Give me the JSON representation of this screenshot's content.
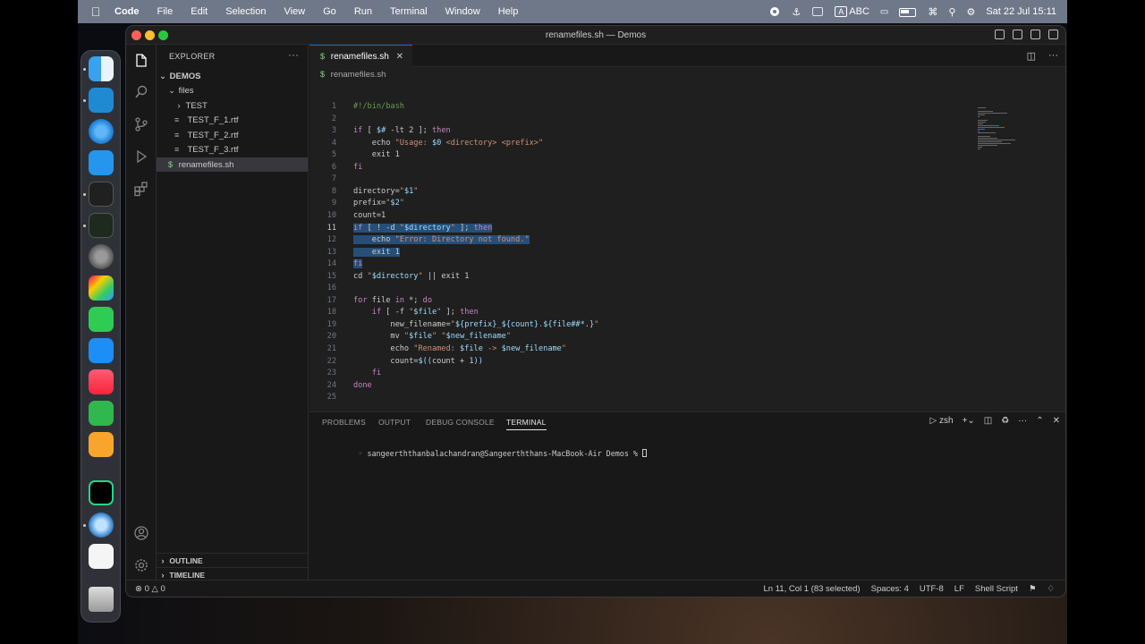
{
  "menubar": {
    "app": "Code",
    "items": [
      "File",
      "Edit",
      "Selection",
      "View",
      "Go",
      "Run",
      "Terminal",
      "Window",
      "Help"
    ],
    "input_source": "ABC",
    "datetime": "Sat 22 Jul  15:11"
  },
  "window": {
    "title": "renamefiles.sh — Demos"
  },
  "sidebar": {
    "header": "EXPLORER",
    "more": "···",
    "root": "DEMOS",
    "tree": [
      {
        "label": "files"
      },
      {
        "label": "TEST"
      },
      {
        "label": "TEST_F_1.rtf"
      },
      {
        "label": "TEST_F_2.rtf"
      },
      {
        "label": "TEST_F_3.rtf"
      },
      {
        "label": "renamefiles.sh"
      }
    ],
    "outline": "OUTLINE",
    "timeline": "TIMELINE"
  },
  "editor": {
    "tab": "renamefiles.sh",
    "breadcrumb": "renamefiles.sh",
    "current_line": 11
  },
  "panel": {
    "tabs": [
      "PROBLEMS",
      "OUTPUT",
      "DEBUG CONSOLE",
      "TERMINAL"
    ],
    "active_tab": "TERMINAL",
    "shell": "zsh",
    "prompt": "sangeerththanbalachandran@Sangeerththans-MacBook-Air Demos % "
  },
  "statusbar": {
    "errors": "0",
    "warnings": "0",
    "position": "Ln 11, Col 1 (83 selected)",
    "spaces": "Spaces: 4",
    "encoding": "UTF-8",
    "eol": "LF",
    "language": "Shell Script"
  },
  "code_lines": [
    [
      [
        "cmt",
        "#!/bin/bash"
      ]
    ],
    [],
    [
      [
        "kw",
        "if"
      ],
      [
        "plain",
        " [ "
      ],
      [
        "var",
        "$#"
      ],
      [
        "plain",
        " -lt 2 ]; "
      ],
      [
        "kw",
        "then"
      ]
    ],
    [
      [
        "plain",
        "    echo "
      ],
      [
        "str",
        "\"Usage: "
      ],
      [
        "var",
        "$0"
      ],
      [
        "str",
        " <directory> <prefix>\""
      ]
    ],
    [
      [
        "plain",
        "    exit 1"
      ]
    ],
    [
      [
        "kw",
        "fi"
      ]
    ],
    [],
    [
      [
        "plain",
        "directory="
      ],
      [
        "str",
        "\""
      ],
      [
        "var",
        "$1"
      ],
      [
        "str",
        "\""
      ]
    ],
    [
      [
        "plain",
        "prefix="
      ],
      [
        "str",
        "\""
      ],
      [
        "var",
        "$2"
      ],
      [
        "str",
        "\""
      ]
    ],
    [
      [
        "plain",
        "count=1"
      ]
    ],
    [
      [
        "kw",
        "if"
      ],
      [
        "plain",
        " [ ! -d "
      ],
      [
        "str",
        "\""
      ],
      [
        "var",
        "$directory"
      ],
      [
        "str",
        "\""
      ],
      [
        "plain",
        " ]; "
      ],
      [
        "kw",
        "then"
      ]
    ],
    [
      [
        "plain",
        "    echo "
      ],
      [
        "str",
        "\"Error: Directory not found.\""
      ]
    ],
    [
      [
        "plain",
        "    exit 1"
      ]
    ],
    [
      [
        "kw",
        "fi"
      ]
    ],
    [
      [
        "plain",
        "cd "
      ],
      [
        "str",
        "\""
      ],
      [
        "var",
        "$directory"
      ],
      [
        "str",
        "\""
      ],
      [
        "plain",
        " || exit 1"
      ]
    ],
    [],
    [
      [
        "kw",
        "for"
      ],
      [
        "plain",
        " file "
      ],
      [
        "kw",
        "in"
      ],
      [
        "plain",
        " *; "
      ],
      [
        "kw",
        "do"
      ]
    ],
    [
      [
        "plain",
        "    "
      ],
      [
        "kw",
        "if"
      ],
      [
        "plain",
        " [ -f "
      ],
      [
        "str",
        "\""
      ],
      [
        "var",
        "$file"
      ],
      [
        "str",
        "\""
      ],
      [
        "plain",
        " ]; "
      ],
      [
        "kw",
        "then"
      ]
    ],
    [
      [
        "plain",
        "        new_filename="
      ],
      [
        "str",
        "\""
      ],
      [
        "var",
        "${prefix}"
      ],
      [
        "str",
        "_"
      ],
      [
        "var",
        "${count}"
      ],
      [
        "str",
        "."
      ],
      [
        "var",
        "${file##*.}"
      ],
      [
        "str",
        "\""
      ]
    ],
    [
      [
        "plain",
        "        mv "
      ],
      [
        "str",
        "\""
      ],
      [
        "var",
        "$file"
      ],
      [
        "str",
        "\""
      ],
      [
        "plain",
        " "
      ],
      [
        "str",
        "\""
      ],
      [
        "var",
        "$new_filename"
      ],
      [
        "str",
        "\""
      ]
    ],
    [
      [
        "plain",
        "        echo "
      ],
      [
        "str",
        "\"Renamed: "
      ],
      [
        "var",
        "$file"
      ],
      [
        "str",
        " -> "
      ],
      [
        "var",
        "$new_filename"
      ],
      [
        "str",
        "\""
      ]
    ],
    [
      [
        "plain",
        "        count="
      ],
      [
        "var",
        "$(("
      ],
      [
        "plain",
        "count + 1"
      ],
      [
        "var",
        "))"
      ]
    ],
    [
      [
        "plain",
        "    "
      ],
      [
        "kw",
        "fi"
      ]
    ],
    [
      [
        "kw",
        "done"
      ]
    ],
    []
  ],
  "selection": {
    "from_line": 11,
    "to_line": 14
  },
  "colors": {
    "accent": "#0078d4",
    "selection": "#264f78"
  }
}
